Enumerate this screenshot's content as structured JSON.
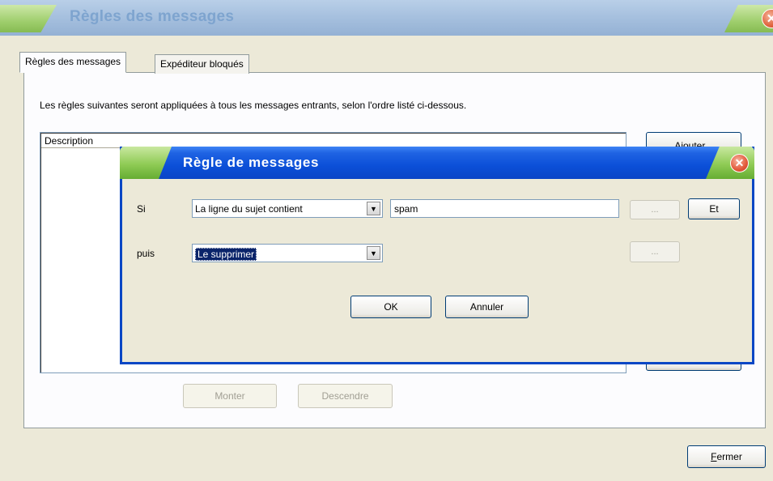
{
  "outer_window": {
    "title": "Règles des messages",
    "close_glyph": "✕"
  },
  "tabs": [
    {
      "label": "Règles des messages",
      "active": true
    },
    {
      "label": "Expéditeur bloqués",
      "active": false
    }
  ],
  "rules_panel": {
    "intro": "Les règles suivantes seront appliquées à tous les messages entrants, selon l'ordre listé ci-dessous.",
    "list_header": "Description",
    "add_button": "Ajouter...",
    "up_button": "Monter",
    "down_button": "Descendre"
  },
  "footer": {
    "close_button_hotkey": "F",
    "close_button_rest": "ermer"
  },
  "dialog": {
    "title": "Règle de messages",
    "close_glyph": "✕",
    "if_label": "Si",
    "condition_value": "La ligne du sujet contient",
    "condition_text": "spam",
    "condition_more_button": "...",
    "and_button": "Et",
    "then_label": "puis",
    "action_value": "Le supprimer",
    "action_more_button": "...",
    "ok_button": "OK",
    "cancel_button": "Annuler",
    "dropdown_arrow": "▼"
  },
  "colors": {
    "dialog_title_blue": "#0a47c5",
    "tab_green": "#8fcb55",
    "close_red": "#e2593a",
    "selection_navy": "#0a246a"
  }
}
